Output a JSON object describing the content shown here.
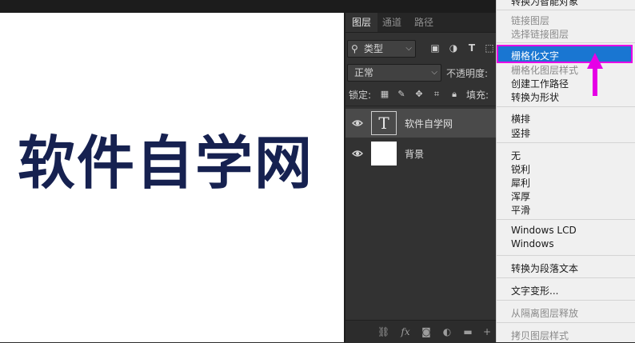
{
  "canvas": {
    "text": "软件自学网",
    "text_color": "#162150"
  },
  "layers_panel": {
    "tabs": [
      "图层",
      "通道",
      "路径"
    ],
    "filter_kind": "类型",
    "blend_mode": "正常",
    "opacity_label": "不透明度:",
    "lock_label": "锁定:",
    "fill_label": "填充:",
    "layers": [
      {
        "name": "软件自学网",
        "type": "text",
        "selected": true
      },
      {
        "name": "背景",
        "type": "background",
        "selected": false
      }
    ]
  },
  "context_menu": {
    "top_partial": "转换为智能对象",
    "link_layers": "链接图层",
    "select_linked": "选择链接图层",
    "rasterize_type": "栅格化文字",
    "rasterize_layer_style": "栅格化图层样式",
    "create_work_path": "创建工作路径",
    "convert_to_shape": "转换为形状",
    "horizontal": "横排",
    "vertical": "竖排",
    "aa_none": "无",
    "aa_sharp": "锐利",
    "aa_crisp": "犀利",
    "aa_strong": "浑厚",
    "aa_smooth": "平滑",
    "aa_windows_lcd": "Windows LCD",
    "aa_windows": "Windows",
    "convert_paragraph": "转换为段落文本",
    "warp_text": "文字变形...",
    "release_isolation": "从隔离图层释放",
    "copy_layer_style": "拷贝图层样式",
    "highlight_color": "#1976d2",
    "annotation_color": "#e600e6"
  }
}
